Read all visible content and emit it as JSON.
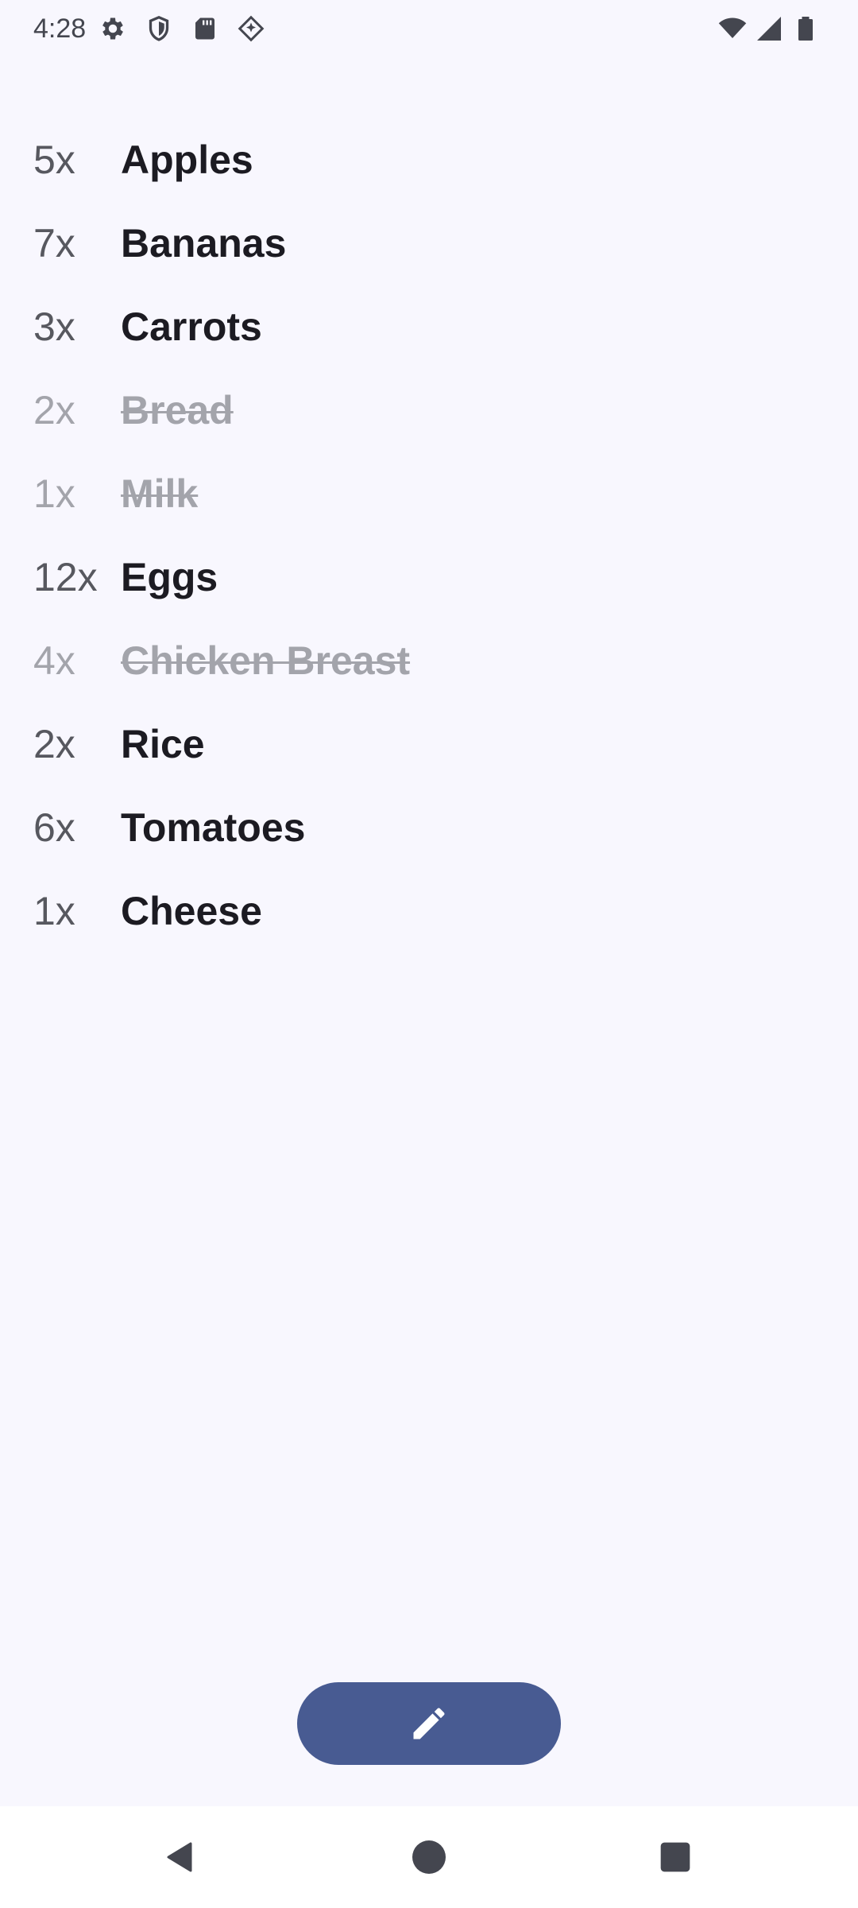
{
  "status_bar": {
    "time": "4:28",
    "left_icons": [
      "settings-icon",
      "shield-icon",
      "sd-card-icon",
      "diamond-icon"
    ],
    "right_icons": [
      "wifi-icon",
      "cell-signal-icon",
      "battery-icon"
    ]
  },
  "items": [
    {
      "qty": "5x",
      "name": "Apples",
      "done": false
    },
    {
      "qty": "7x",
      "name": "Bananas",
      "done": false
    },
    {
      "qty": "3x",
      "name": "Carrots",
      "done": false
    },
    {
      "qty": "2x",
      "name": "Bread",
      "done": true
    },
    {
      "qty": "1x",
      "name": "Milk",
      "done": true
    },
    {
      "qty": "12x",
      "name": "Eggs",
      "done": false
    },
    {
      "qty": "4x",
      "name": "Chicken Breast",
      "done": true
    },
    {
      "qty": "2x",
      "name": "Rice",
      "done": false
    },
    {
      "qty": "6x",
      "name": "Tomatoes",
      "done": false
    },
    {
      "qty": "1x",
      "name": "Cheese",
      "done": false
    }
  ],
  "fab": {
    "icon": "edit-pencil-icon"
  },
  "colors": {
    "background": "#f8f7fe",
    "fab": "#485b92",
    "text_active": "#1c1b22",
    "text_done": "#a3a4ab"
  },
  "nav": {
    "back": "back-icon",
    "home": "home-icon",
    "recents": "recents-icon"
  }
}
